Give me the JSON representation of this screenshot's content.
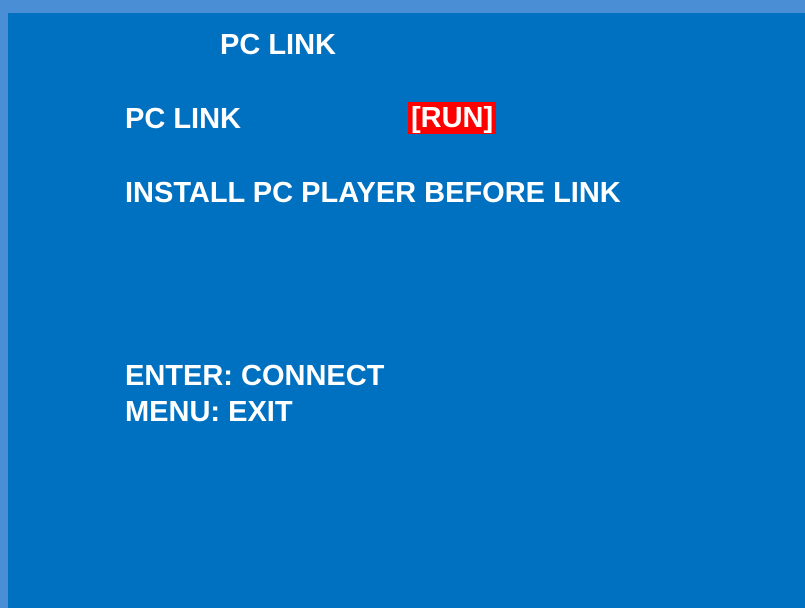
{
  "screen": {
    "title": "PC LINK",
    "pc_link": {
      "label": "PC LINK",
      "value": "[RUN]",
      "value_highlight_color": "#ff0000"
    },
    "note": "INSTALL PC PLAYER BEFORE LINK",
    "hints": [
      "ENTER: CONNECT",
      "MENU: EXIT"
    ],
    "background_color": "#0070c0",
    "border_color": "#4a8fd6"
  }
}
